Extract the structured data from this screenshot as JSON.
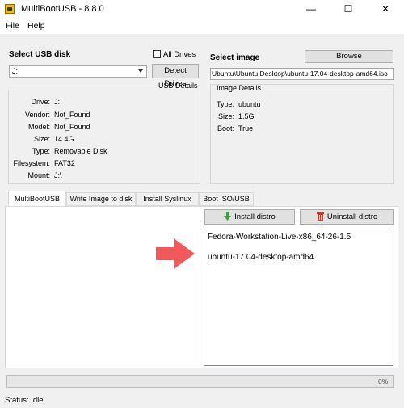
{
  "window": {
    "title": "MultiBootUSB - 8.8.0",
    "minimize_glyph": "—",
    "maximize_glyph": "☐",
    "close_glyph": "✕"
  },
  "menu": {
    "file": "File",
    "help": "Help"
  },
  "usb": {
    "section_label": "Select USB disk",
    "all_drives_label": "All Drives",
    "selected_disk": "J:",
    "detect_button": "Detect Drives",
    "details_title": "USB Details",
    "details": [
      {
        "label": "Drive:",
        "value": "J:"
      },
      {
        "label": "Vendor:",
        "value": "Not_Found"
      },
      {
        "label": "Model:",
        "value": "Not_Found"
      },
      {
        "label": "Size:",
        "value": "14.4G"
      },
      {
        "label": "Type:",
        "value": "Removable Disk"
      },
      {
        "label": "Filesystem:",
        "value": "FAT32"
      },
      {
        "label": "Mount:",
        "value": "J:\\"
      }
    ]
  },
  "image": {
    "section_label": "Select image",
    "browse_button": "Browse",
    "path": "Ubuntu\\Ubuntu Desktop\\ubuntu-17.04-desktop-amd64.iso",
    "details_title": "Image Details",
    "details": [
      {
        "label": "Type:",
        "value": "ubuntu"
      },
      {
        "label": "Size:",
        "value": "1.5G"
      },
      {
        "label": "Boot:",
        "value": "True"
      }
    ]
  },
  "tabs": [
    "MultiBootUSB",
    "Write Image to disk",
    "Install Syslinux",
    "Boot ISO/USB"
  ],
  "actions": {
    "install": "Install distro",
    "uninstall": "Uninstall distro"
  },
  "distros": [
    "Fedora-Workstation-Live-x86_64-26-1.5",
    "ubuntu-17.04-desktop-amd64"
  ],
  "progress": {
    "percent_label": "0%",
    "value": 0
  },
  "status": "Status: Idle",
  "colors": {
    "arrow": "#f05a5a",
    "install_icon": "#3aa33a",
    "uninstall_icon": "#d93025"
  }
}
